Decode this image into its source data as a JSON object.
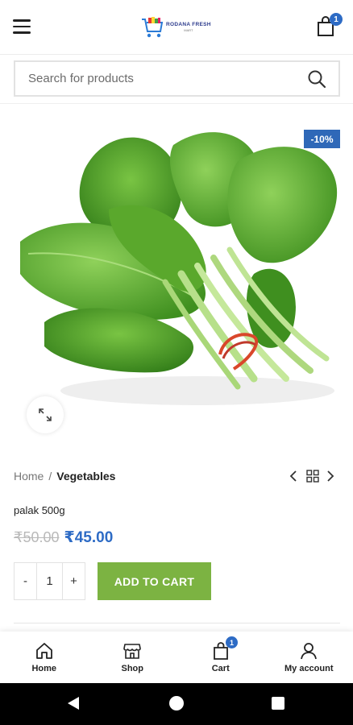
{
  "header": {
    "logo": {
      "name": "RODANA FRESH",
      "tagline": "MART"
    },
    "cart_count": "1"
  },
  "search": {
    "placeholder": "Search for products",
    "value": ""
  },
  "product": {
    "discount_badge": "-10%",
    "name": "palak 500g",
    "old_price": "₹50.00",
    "new_price": "₹45.00",
    "quantity": "1",
    "minus_label": "-",
    "plus_label": "+",
    "add_to_cart_label": "ADD TO CART"
  },
  "breadcrumb": {
    "home": "Home",
    "separator": "/",
    "current": "Vegetables"
  },
  "bottom_nav": {
    "items": [
      {
        "label": "Home",
        "icon": "home-icon"
      },
      {
        "label": "Shop",
        "icon": "shop-icon"
      },
      {
        "label": "Cart",
        "icon": "cart-icon",
        "badge": "1"
      },
      {
        "label": "My account",
        "icon": "user-icon"
      }
    ]
  },
  "colors": {
    "accent_blue": "#2d6bc5",
    "add_to_cart_green": "#7cb342",
    "discount_badge_blue": "#2f68b8"
  }
}
